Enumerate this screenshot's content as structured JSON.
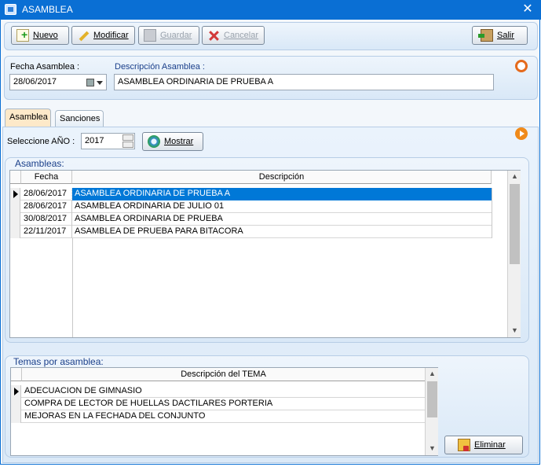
{
  "window": {
    "title": "ASAMBLEA",
    "close_glyph": "✕",
    "icon": "app-window-icon"
  },
  "toolbar": {
    "new_label": "Nuevo",
    "edit_label": "Modificar",
    "save_label": "Guardar",
    "cancel_label": "Cancelar",
    "exit_label": "Salir"
  },
  "header": {
    "date_label": "Fecha Asamblea :",
    "date_value": "28/06/2017",
    "desc_label": "Descripción Asamblea :",
    "desc_value": "ASAMBLEA ORDINARIA DE PRUEBA A"
  },
  "tabs": [
    {
      "label": "Asamblea",
      "active": true
    },
    {
      "label": "Sanciones",
      "active": false
    }
  ],
  "year_filter": {
    "label": "Seleccione AÑO :",
    "value": "2017",
    "show_label": "Mostrar"
  },
  "asambleas": {
    "title": "Asambleas:",
    "columns": [
      "Fecha",
      "Descripción"
    ],
    "rows": [
      {
        "fecha": "28/06/2017",
        "descripcion": "ASAMBLEA ORDINARIA DE PRUEBA A",
        "selected": true
      },
      {
        "fecha": "28/06/2017",
        "descripcion": "ASAMBLEA ORDINARIA DE JULIO 01",
        "selected": false
      },
      {
        "fecha": "30/08/2017",
        "descripcion": "ASAMBLEA ORDINARIA DE PRUEBA",
        "selected": false
      },
      {
        "fecha": "22/11/2017",
        "descripcion": "ASAMBLEA DE PRUEBA PARA BITACORA",
        "selected": false
      }
    ]
  },
  "temas": {
    "title": "Temas por asamblea:",
    "columns": [
      "Descripción del TEMA"
    ],
    "rows": [
      "ADECUACION DE GIMNASIO",
      "COMPRA DE LECTOR DE HUELLAS DACTILARES PORTERIA",
      "MEJORAS EN LA FECHADA DEL CONJUNTO"
    ],
    "delete_label": "Eliminar"
  },
  "colors": {
    "titlebar": "#0a6fd4",
    "selection": "#0078d7",
    "section_title": "#1a3f8a",
    "active_tab": "#fde9c9"
  }
}
